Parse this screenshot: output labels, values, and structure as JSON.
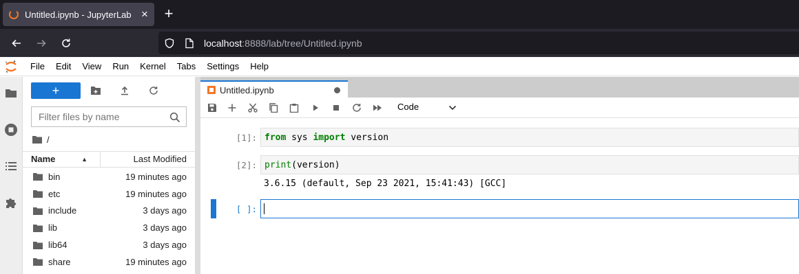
{
  "browser": {
    "tab_title": "Untitled.ipynb - JupyterLab",
    "url_host": "localhost",
    "url_rest": ":8888/lab/tree/Untitled.ipynb"
  },
  "menubar": {
    "items": [
      "File",
      "Edit",
      "View",
      "Run",
      "Kernel",
      "Tabs",
      "Settings",
      "Help"
    ]
  },
  "filebrowser": {
    "new_label": "+",
    "filter_placeholder": "Filter files by name",
    "breadcrumb": "/",
    "columns": {
      "name": "Name",
      "modified": "Last Modified"
    },
    "files": [
      {
        "name": "bin",
        "modified": "19 minutes ago"
      },
      {
        "name": "etc",
        "modified": "19 minutes ago"
      },
      {
        "name": "include",
        "modified": "3 days ago"
      },
      {
        "name": "lib",
        "modified": "3 days ago"
      },
      {
        "name": "lib64",
        "modified": "3 days ago"
      },
      {
        "name": "share",
        "modified": "19 minutes ago"
      }
    ]
  },
  "notebook": {
    "tab_label": "Untitled.ipynb",
    "cell_type": "Code",
    "cells": [
      {
        "prompt": "[1]:",
        "code_kw1": "from",
        "code_mid": " sys ",
        "code_kw2": "import",
        "code_end": " version"
      },
      {
        "prompt": "[2]:",
        "code_fn": "print",
        "code_end": "(version)",
        "output": "3.6.15 (default, Sep 23 2021, 15:41:43) [GCC]"
      },
      {
        "prompt": "[ ]:"
      }
    ]
  },
  "colors": {
    "accent": "#1976d2",
    "jupyter_orange": "#f37726",
    "keyword_green": "#008000"
  }
}
